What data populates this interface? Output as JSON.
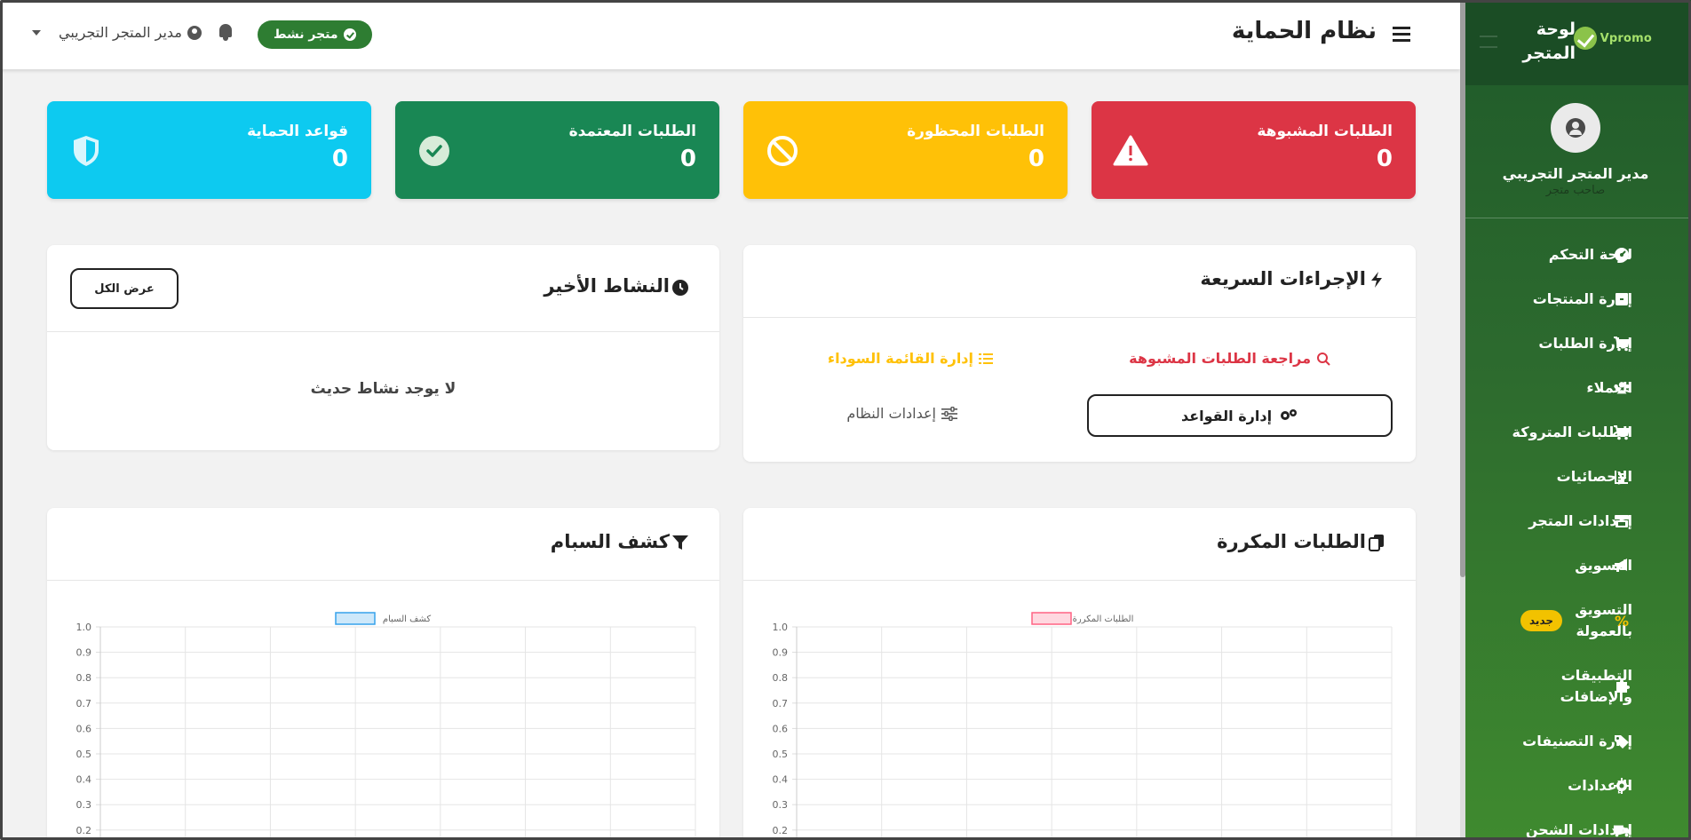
{
  "topbar": {
    "title": "نظام الحماية",
    "store_status": "متجر نشط",
    "user_name": "مدير المتجر التجريبي"
  },
  "sidebar": {
    "title": "لوحة المتجر",
    "logo_text": "Vpromo",
    "user_name": "مدير المتجر التجريبي",
    "user_role": "صاحب متجر",
    "items": [
      {
        "label": "لوحة التحكم",
        "icon": "dashboard-icon"
      },
      {
        "label": "إدارة المنتجات",
        "icon": "box-icon"
      },
      {
        "label": "إدارة الطلبات",
        "icon": "cart-icon"
      },
      {
        "label": "العملاء",
        "icon": "users-icon"
      },
      {
        "label": "الطلبات المتروكة",
        "icon": "cart-icon"
      },
      {
        "label": "الإحصائيات",
        "icon": "chart-icon"
      },
      {
        "label": "إعدادات المتجر",
        "icon": "store-icon"
      },
      {
        "label": "التسويق",
        "icon": "megaphone-icon"
      },
      {
        "label": "التسويق بالعمولة",
        "icon": "percent-icon",
        "badge": "جديد"
      },
      {
        "label": "التطبيقات والإضافات",
        "icon": "puzzle-icon"
      },
      {
        "label": "إدارة التصنيفات",
        "icon": "tags-icon"
      },
      {
        "label": "الإعدادات",
        "icon": "gear-icon"
      },
      {
        "label": "إعدادات الشحن",
        "icon": "truck-icon"
      }
    ]
  },
  "stats": {
    "suspicious": {
      "label": "الطلبات المشبوهة",
      "value": "0",
      "color": "#dc3545"
    },
    "blocked": {
      "label": "الطلبات المحظورة",
      "value": "0",
      "color": "#ffc107"
    },
    "approved": {
      "label": "الطلبات المعتمدة",
      "value": "0",
      "color": "#198754"
    },
    "rules": {
      "label": "قواعد الحماية",
      "value": "0",
      "color": "#0dcaf0"
    }
  },
  "quick_actions": {
    "title": "الإجراءات السريعة",
    "review_suspicious": "مراجعة الطلبات المشبوهة",
    "manage_blacklist": "إدارة القائمة السوداء",
    "manage_rules": "إدارة القواعد",
    "system_settings": "إعدادات النظام"
  },
  "recent_activity": {
    "title": "النشاط الأخير",
    "view_all": "عرض الكل",
    "empty": "لا يوجد نشاط حديث"
  },
  "duplicate_orders": {
    "title": "الطلبات المكررة"
  },
  "spam_detection": {
    "title": "كشف السبام"
  },
  "chart_data": [
    {
      "type": "line",
      "series": [
        {
          "name": "الطلبات المكررة",
          "values": [],
          "color": "#ff6384"
        }
      ],
      "yticks": [
        "1.0",
        "0.9",
        "0.8",
        "0.7",
        "0.6",
        "0.5",
        "0.4",
        "0.3",
        "0.2"
      ],
      "ylim": [
        0,
        1
      ],
      "grid": true,
      "legend": "top-center"
    },
    {
      "type": "line",
      "series": [
        {
          "name": "كشف السبام",
          "values": [],
          "color": "#36a2eb"
        }
      ],
      "yticks": [
        "1.0",
        "0.9",
        "0.8",
        "0.7",
        "0.6",
        "0.5",
        "0.4",
        "0.3",
        "0.2"
      ],
      "ylim": [
        0,
        1
      ],
      "grid": true,
      "legend": "top-center"
    }
  ]
}
